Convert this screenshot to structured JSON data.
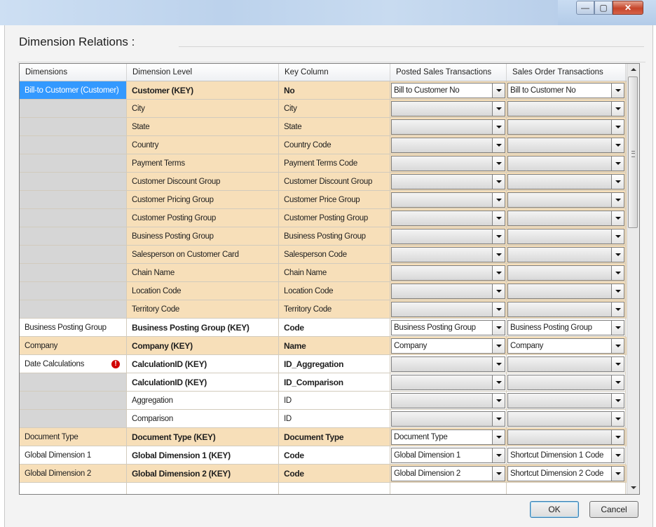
{
  "window": {
    "title": "",
    "minimize_glyph": "—",
    "maximize_glyph": "▢",
    "close_glyph": "✕"
  },
  "dialog": {
    "heading": "Dimension Relations :",
    "ok_label": "OK",
    "cancel_label": "Cancel"
  },
  "columns": [
    "Dimensions",
    "Dimension Level",
    "Key Column",
    "Posted Sales Transactions",
    "Sales Order Transactions"
  ],
  "colors": {
    "row_tan": "#f7dfb9",
    "row_white": "#ffffff",
    "selection_blue": "#3399ff",
    "gray_cell": "#d6d6d6",
    "warning_red": "#d00000"
  },
  "rows": [
    {
      "dimension": "Bill-to Customer (Customer)",
      "level": "Customer (KEY)",
      "key": "No",
      "posted": "Bill to Customer No",
      "order": "Bill to Customer No",
      "style": "tan",
      "bold": true,
      "selected": true
    },
    {
      "dimension": "",
      "level": "City",
      "key": "City",
      "posted": "",
      "order": "",
      "style": "tan",
      "bold": false
    },
    {
      "dimension": "",
      "level": "State",
      "key": "State",
      "posted": "",
      "order": "",
      "style": "tan",
      "bold": false
    },
    {
      "dimension": "",
      "level": "Country",
      "key": "Country Code",
      "posted": "",
      "order": "",
      "style": "tan",
      "bold": false
    },
    {
      "dimension": "",
      "level": "Payment Terms",
      "key": "Payment Terms Code",
      "posted": "",
      "order": "",
      "style": "tan",
      "bold": false
    },
    {
      "dimension": "",
      "level": "Customer Discount Group",
      "key": "Customer Discount Group",
      "posted": "",
      "order": "",
      "style": "tan",
      "bold": false
    },
    {
      "dimension": "",
      "level": "Customer Pricing Group",
      "key": "Customer Price Group",
      "posted": "",
      "order": "",
      "style": "tan",
      "bold": false
    },
    {
      "dimension": "",
      "level": "Customer Posting Group",
      "key": "Customer Posting Group",
      "posted": "",
      "order": "",
      "style": "tan",
      "bold": false
    },
    {
      "dimension": "",
      "level": "Business Posting Group",
      "key": "Business Posting Group",
      "posted": "",
      "order": "",
      "style": "tan",
      "bold": false
    },
    {
      "dimension": "",
      "level": "Salesperson on Customer Card",
      "key": "Salesperson Code",
      "posted": "",
      "order": "",
      "style": "tan",
      "bold": false
    },
    {
      "dimension": "",
      "level": "Chain Name",
      "key": "Chain Name",
      "posted": "",
      "order": "",
      "style": "tan",
      "bold": false
    },
    {
      "dimension": "",
      "level": "Location Code",
      "key": "Location Code",
      "posted": "",
      "order": "",
      "style": "tan",
      "bold": false
    },
    {
      "dimension": "",
      "level": "Territory Code",
      "key": "Territory Code",
      "posted": "",
      "order": "",
      "style": "tan",
      "bold": false
    },
    {
      "dimension": "Business Posting Group",
      "level": "Business Posting Group (KEY)",
      "key": "Code",
      "posted": "Business Posting Group",
      "order": "Business Posting Group",
      "style": "white",
      "bold": true
    },
    {
      "dimension": "Company",
      "level": "Company (KEY)",
      "key": "Name",
      "posted": "Company",
      "order": "Company",
      "style": "tan",
      "bold": true
    },
    {
      "dimension": "Date Calculations",
      "level": "CalculationID (KEY)",
      "key": "ID_Aggregation",
      "posted": "",
      "order": "",
      "style": "white",
      "bold": true,
      "warning": "!"
    },
    {
      "dimension": "",
      "level": "CalculationID (KEY)",
      "key": "ID_Comparison",
      "posted": "",
      "order": "",
      "style": "white",
      "bold": true
    },
    {
      "dimension": "",
      "level": "Aggregation",
      "key": "ID",
      "posted": "",
      "order": "",
      "style": "white",
      "bold": false
    },
    {
      "dimension": "",
      "level": "Comparison",
      "key": "ID",
      "posted": "",
      "order": "",
      "style": "white",
      "bold": false
    },
    {
      "dimension": "Document Type",
      "level": "Document Type (KEY)",
      "key": "Document Type",
      "posted": "Document Type",
      "order": "",
      "style": "tan",
      "bold": true
    },
    {
      "dimension": "Global Dimension 1",
      "level": "Global Dimension 1 (KEY)",
      "key": "Code",
      "posted": "Global Dimension 1",
      "order": "Shortcut Dimension 1 Code",
      "style": "white",
      "bold": true
    },
    {
      "dimension": "Global Dimension 2",
      "level": "Global Dimension 2 (KEY)",
      "key": "Code",
      "posted": "Global Dimension 2",
      "order": "Shortcut Dimension 2 Code",
      "style": "tan",
      "bold": true
    },
    {
      "dimension": "",
      "level": "",
      "key": "",
      "posted": "",
      "order": "",
      "style": "white",
      "bold": false
    }
  ]
}
